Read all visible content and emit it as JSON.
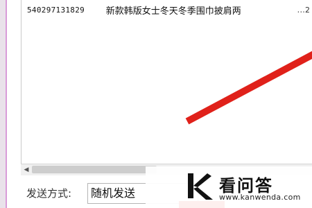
{
  "list": {
    "rows": [
      {
        "id": "540297131829",
        "title": "新款韩版女士冬天冬季围巾披肩两",
        "ellipsis": "...",
        "extra": "2"
      }
    ]
  },
  "bottom_bar": {
    "send_method_label": "发送方式:",
    "send_method_value": "随机发送"
  },
  "watermark": {
    "name": "看问答",
    "url": "www.kanwenda.com"
  },
  "colors": {
    "frame_accent": "#d99bd9",
    "annotation_red": "#e0211a"
  }
}
